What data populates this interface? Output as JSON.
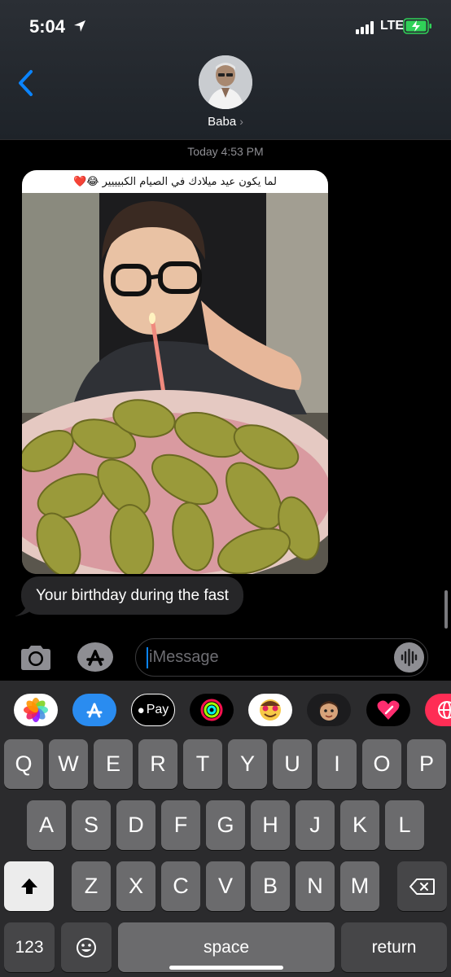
{
  "status_bar": {
    "time": "5:04",
    "network": "LTE",
    "icons": [
      "location-arrow-icon",
      "signal-icon",
      "battery-charging-icon"
    ]
  },
  "contact": {
    "name": "Baba",
    "chevron": "›"
  },
  "conversation": {
    "timestamp": "Today 4:53 PM",
    "image_caption_text": "لما يكون عيد ميلادك في الصيام الكبيييير 😂❤️",
    "message_text": "Your birthday during the fast"
  },
  "input": {
    "placeholder": "iMessage",
    "accent_color": "#0a84ff"
  },
  "app_drawer": [
    {
      "name": "photos-app-icon"
    },
    {
      "name": "app-store-icon"
    },
    {
      "name": "apple-pay-icon",
      "label": "Pay"
    },
    {
      "name": "activity-icon"
    },
    {
      "name": "memoji-stickers-icon"
    },
    {
      "name": "animoji-icon"
    },
    {
      "name": "digital-touch-icon"
    },
    {
      "name": "globe-app-icon"
    }
  ],
  "keyboard": {
    "row1": [
      "Q",
      "W",
      "E",
      "R",
      "T",
      "Y",
      "U",
      "I",
      "O",
      "P"
    ],
    "row2": [
      "A",
      "S",
      "D",
      "F",
      "G",
      "H",
      "J",
      "K",
      "L"
    ],
    "row3": [
      "Z",
      "X",
      "C",
      "V",
      "B",
      "N",
      "M"
    ],
    "numbers_label": "123",
    "space_label": "space",
    "return_label": "return"
  },
  "colors": {
    "accent": "#0a84ff",
    "bubble_gray": "#262628",
    "key_gray": "#6b6b6d",
    "battery_green": "#30d158"
  }
}
